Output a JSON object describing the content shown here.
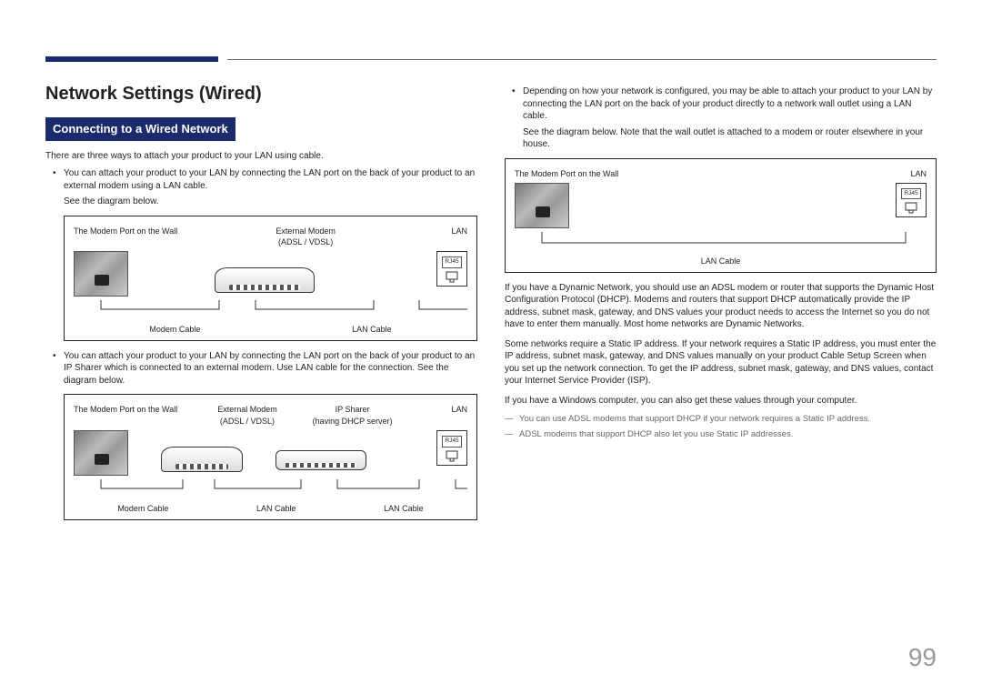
{
  "page_number": "99",
  "h1": "Network Settings (Wired)",
  "h2": "Connecting to a Wired Network",
  "intro": "There are three ways to attach your product to your LAN using cable.",
  "left_bullets": [
    {
      "text": "You can attach your product to your LAN by connecting the LAN port on the back of your product to an external modem using a LAN cable.",
      "sub": "See the diagram below."
    },
    {
      "text": "You can attach your product to your LAN by connecting the LAN port on the back of your product to an IP Sharer which is connected to an external modem. Use LAN cable for the connection. See the diagram below."
    }
  ],
  "right_bullets": [
    {
      "text": "Depending on how your network is configured, you may be able to attach your product to your LAN by connecting the LAN port on the back of your product directly to a network wall outlet using a LAN cable.",
      "sub": "See the diagram below. Note that the wall outlet is attached to a modem or router elsewhere in your house."
    }
  ],
  "diagram1": {
    "wall_label": "The Modem Port on the Wall",
    "modem_label": "External Modem",
    "modem_sub": "(ADSL / VDSL)",
    "lan": "LAN",
    "rj": "RJ45",
    "cable1": "Modem Cable",
    "cable2": "LAN Cable"
  },
  "diagram2": {
    "wall_label": "The Modem Port on the Wall",
    "modem_label": "External Modem",
    "modem_sub": "(ADSL / VDSL)",
    "sharer_label": "IP Sharer",
    "sharer_sub": "(having DHCP server)",
    "lan": "LAN",
    "rj": "RJ45",
    "cable1": "Modem Cable",
    "cable2": "LAN Cable",
    "cable3": "LAN Cable"
  },
  "diagram3": {
    "wall_label": "The Modem Port on the Wall",
    "lan": "LAN",
    "rj": "RJ45",
    "cable1": "LAN Cable"
  },
  "right_paras": [
    "If you have a Dynamic Network, you should use an ADSL modem or router that supports the Dynamic Host Configuration Protocol (DHCP). Modems and routers that support DHCP automatically provide the IP address, subnet mask, gateway, and DNS values your product needs to access the Internet so you do not have to enter them manually. Most home networks are Dynamic Networks.",
    "Some networks require a Static IP address. If your network requires a Static IP address, you must enter the IP address, subnet mask, gateway, and DNS values manually on your product Cable Setup Screen when you set up the network connection. To get the IP address, subnet mask, gateway, and DNS values, contact your Internet Service Provider (ISP).",
    "If you have a Windows computer, you can also get these values through your computer."
  ],
  "notes": [
    "You can use ADSL modems that support DHCP if your network requires a Static IP address.",
    "ADSL modems that support DHCP also let you use Static IP addresses."
  ]
}
